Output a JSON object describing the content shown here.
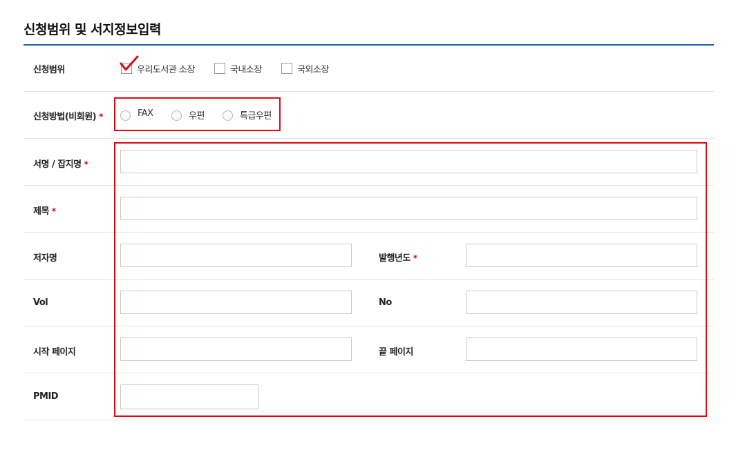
{
  "section": {
    "title": "신청범위 및 서지정보입력"
  },
  "scope": {
    "label": "신청범위",
    "options": [
      {
        "label": "우리도서관 소장",
        "checked": true
      },
      {
        "label": "국내소장",
        "checked": false
      },
      {
        "label": "국외소장",
        "checked": false
      }
    ]
  },
  "method": {
    "label": "신청방법(비회원)",
    "required_mark": "*",
    "options": [
      {
        "label": "FAX"
      },
      {
        "label": "우편"
      },
      {
        "label": "특급우편"
      }
    ]
  },
  "fields": {
    "book_title": {
      "label": "서명 / 잡지명",
      "required_mark": "*",
      "value": ""
    },
    "article_title": {
      "label": "제목",
      "required_mark": "*",
      "value": ""
    },
    "author": {
      "label": "저자명",
      "value": ""
    },
    "pub_year": {
      "label": "발행년도",
      "required_mark": "*",
      "value": ""
    },
    "vol": {
      "label": "Vol",
      "value": ""
    },
    "no": {
      "label": "No",
      "value": ""
    },
    "start_page": {
      "label": "시작 페이지",
      "value": ""
    },
    "end_page": {
      "label": "끝 페이지",
      "value": ""
    },
    "pmid": {
      "label": "PMID",
      "value": ""
    }
  },
  "colors": {
    "accent_line": "#1f5fa8",
    "highlight": "#e30613",
    "required": "#d0021b"
  }
}
